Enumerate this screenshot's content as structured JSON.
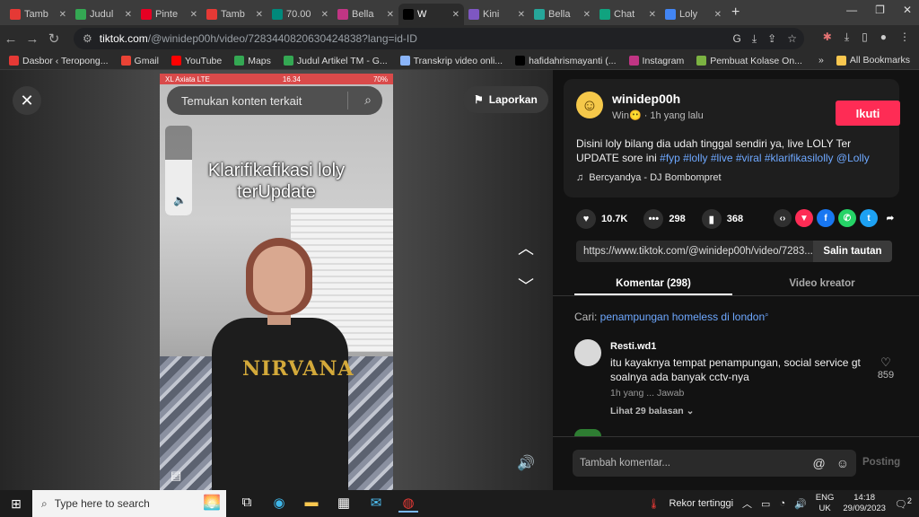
{
  "browser": {
    "tabs": [
      {
        "title": "Tamb",
        "color": "#e53935"
      },
      {
        "title": "Judul",
        "color": "#34a853"
      },
      {
        "title": "Pinte",
        "color": "#e60023"
      },
      {
        "title": "Tamb",
        "color": "#e53935"
      },
      {
        "title": "70.00",
        "color": "#00897b"
      },
      {
        "title": "Bella",
        "color": "#c13584"
      },
      {
        "title": "W",
        "color": "#000000"
      },
      {
        "title": "Kini",
        "color": "#7e57c2"
      },
      {
        "title": "Bella",
        "color": "#26a69a"
      },
      {
        "title": "Chat",
        "color": "#10a37f"
      },
      {
        "title": "Loly",
        "color": "#4285f4"
      }
    ],
    "active_tab_index": 6,
    "url_host": "tiktok.com",
    "url_path": "/@winidep00h/video/7283440820630424838?lang=id-ID",
    "bookmarks": [
      {
        "label": "Dasbor ‹ Teropong...",
        "color": "#e53935"
      },
      {
        "label": "Gmail",
        "color": "#ea4335"
      },
      {
        "label": "YouTube",
        "color": "#ff0000"
      },
      {
        "label": "Maps",
        "color": "#34a853"
      },
      {
        "label": "Judul Artikel TM - G...",
        "color": "#34a853"
      },
      {
        "label": "Transkrip video onli...",
        "color": "#8ab4f8"
      },
      {
        "label": "hafidahrismayanti (...",
        "color": "#000000"
      },
      {
        "label": "Instagram",
        "color": "#c13584"
      },
      {
        "label": "Pembuat Kolase On...",
        "color": "#7cb342"
      }
    ],
    "bookmarks_more": "»",
    "all_bookmarks": "All Bookmarks"
  },
  "video": {
    "search_placeholder": "Temukan konten terkait",
    "report_label": "Laporkan",
    "caption": "Klarifikafikasi loly terUpdate",
    "status_left": "XL Axiata  LTE",
    "status_time": "16.34",
    "status_right": "70%",
    "shirt_text": "NIRVANA",
    "volume_level": 0.62
  },
  "post": {
    "username": "winidep00h",
    "meta": "Win😶 · 1h yang lalu",
    "follow_label": "Ikuti",
    "description_text": "Disini loly bilang dia udah tinggal sendiri ya, live LOLY Ter UPDATE sore ini ",
    "hashtags": "#fyp #lolly #live #viral #klarifikasilolly @Lolly",
    "music": "Bercyandya - DJ Bombompret",
    "likes": "10.7K",
    "comments_count": "298",
    "saves": "368",
    "link": "https://www.tiktok.com/@winidep00h/video/7283...",
    "copy_label": "Salin tautan"
  },
  "tabs": {
    "comments": "Komentar (298)",
    "creator": "Video kreator"
  },
  "search_hint": {
    "prefix": "Cari: ",
    "query": "penampungan homeless di london"
  },
  "comments": [
    {
      "user": "Resti.wd1",
      "text": "itu kayaknya tempat penampungan, social service gt soalnya ada banyak cctv-nya",
      "meta": "1h yang ...   Jawab",
      "likes": "859",
      "replies": "Lihat 29 balasan ⌄"
    }
  ],
  "compose": {
    "placeholder": "Tambah komentar...",
    "post_label": "Posting"
  },
  "taskbar": {
    "search_placeholder": "Type here to search",
    "weather": "Rekor tertinggi",
    "lang_top": "ENG",
    "lang_bottom": "UK",
    "time": "14:18",
    "date": "29/09/2023",
    "notif_count": "2"
  },
  "colors": {
    "accent": "#fe2c55",
    "link": "#6ea8ff"
  }
}
